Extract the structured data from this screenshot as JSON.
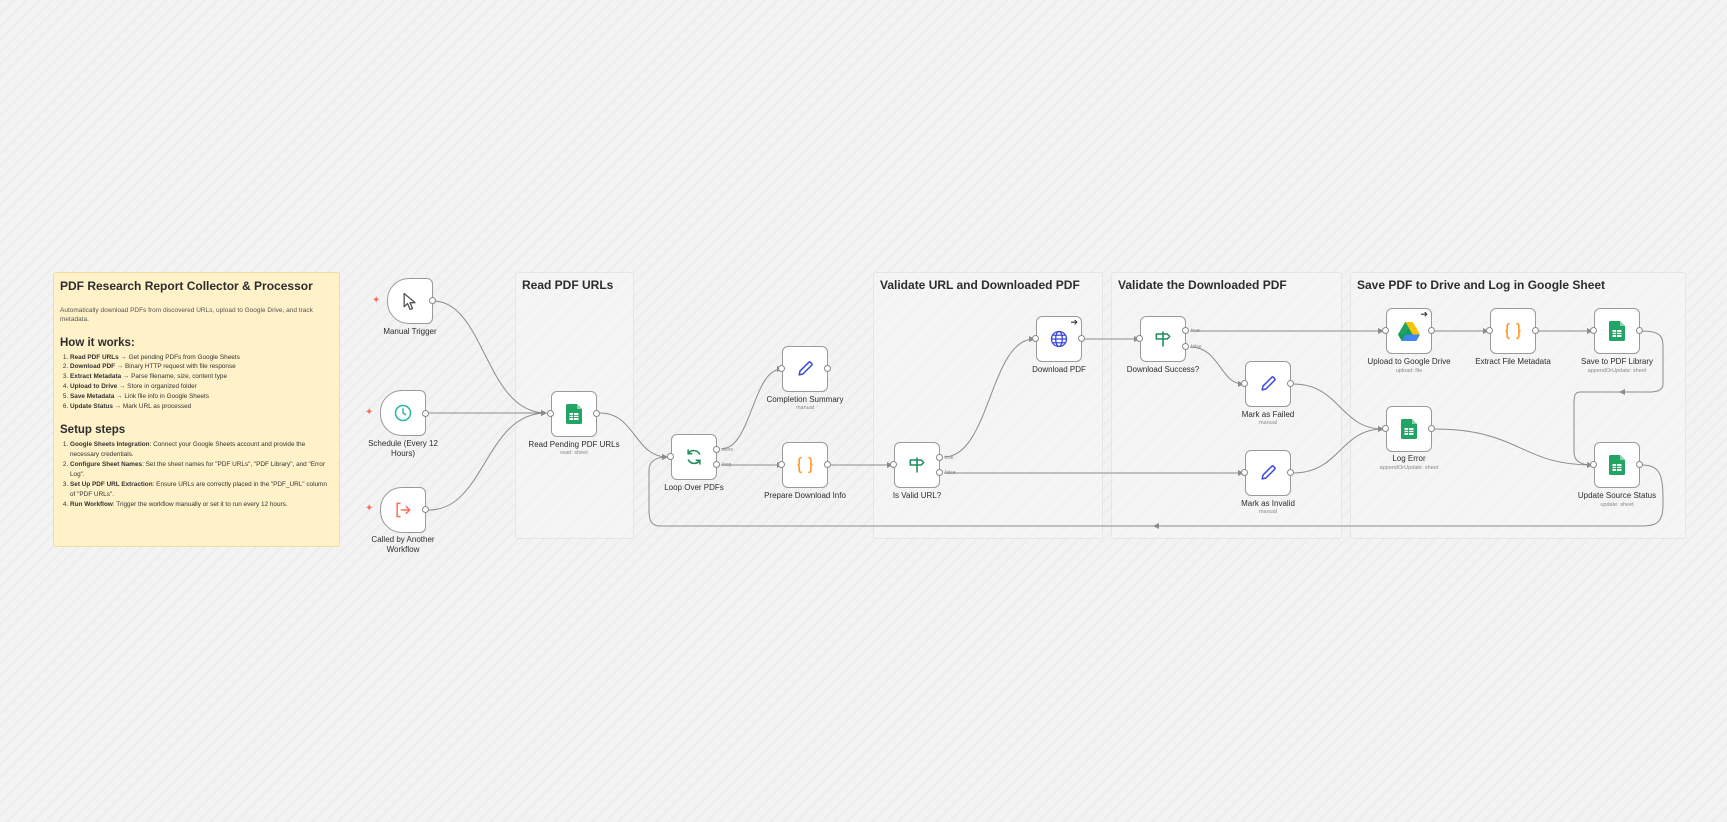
{
  "sticky": {
    "title": "PDF Research Report Collector & Processor",
    "description": "Automatically download PDFs from discovered URLs, upload to Google Drive, and track metadata.",
    "how_heading": "How it works:",
    "how_steps": [
      {
        "bold": "Read PDF URLs",
        "text": " → Get pending PDFs from Google Sheets"
      },
      {
        "bold": "Download PDF",
        "text": " → Binary HTTP request with file response"
      },
      {
        "bold": "Extract Metadata",
        "text": " → Parse filename, size, content type"
      },
      {
        "bold": "Upload to Drive",
        "text": " → Store in organized folder"
      },
      {
        "bold": "Save Metadata",
        "text": " → Link file info in Google Sheets"
      },
      {
        "bold": "Update Status",
        "text": " → Mark URL as processed"
      }
    ],
    "setup_heading": "Setup steps",
    "setup_steps": [
      {
        "bold": "Google Sheets Integration",
        "text": ": Connect your Google Sheets account and provide the necessary credentials."
      },
      {
        "bold": "Configure Sheet Names",
        "text": ": Set the sheet names for \"PDF URLs\", \"PDF Library\", and \"Error Log\"."
      },
      {
        "bold": "Set Up PDF URL Extraction",
        "text": ": Ensure URLs are correctly placed in the \"PDF_URL\" column of \"PDF URLs\"."
      },
      {
        "bold": "Run Workflow",
        "text": ": Trigger the workflow manually or set it to run every 12 hours."
      }
    ]
  },
  "groups": {
    "read_urls": "Read PDF URLs",
    "validate_url": "Validate URL and Downloaded PDF",
    "validate_pdf": "Validate the Downloaded PDF",
    "save_drive": "Save PDF to Drive and Log in Google Sheet"
  },
  "nodes": {
    "manual_trigger": {
      "label": "Manual Trigger",
      "icon": "cursor-icon"
    },
    "schedule": {
      "label": "Schedule (Every 12 Hours)",
      "icon": "clock-icon"
    },
    "called_by_workflow": {
      "label": "Called by Another Workflow",
      "icon": "sign-in-icon"
    },
    "read_pending": {
      "label": "Read Pending PDF URLs",
      "sub": "read: sheet",
      "icon": "google-sheets-icon"
    },
    "loop": {
      "label": "Loop Over PDFs",
      "icon": "loop-icon",
      "ports": {
        "done": "done",
        "loop": "loop"
      }
    },
    "completion": {
      "label": "Completion Summary",
      "sub": "manual",
      "icon": "pencil-icon"
    },
    "prepare": {
      "label": "Prepare Download Info",
      "icon": "code-braces-icon"
    },
    "is_valid": {
      "label": "Is Valid URL?",
      "icon": "signpost-icon",
      "ports": {
        "true": "true",
        "false": "false"
      }
    },
    "download": {
      "label": "Download PDF",
      "icon": "globe-icon"
    },
    "download_success": {
      "label": "Download Success?",
      "icon": "signpost-icon",
      "ports": {
        "true": "true",
        "false": "false"
      }
    },
    "mark_failed": {
      "label": "Mark as Failed",
      "sub": "manual",
      "icon": "pencil-icon"
    },
    "mark_invalid": {
      "label": "Mark as Invalid",
      "sub": "manual",
      "icon": "pencil-icon"
    },
    "upload_drive": {
      "label": "Upload to Google Drive",
      "sub": "upload: file",
      "icon": "google-drive-icon"
    },
    "extract_meta": {
      "label": "Extract File Metadata",
      "icon": "code-braces-icon"
    },
    "save_library": {
      "label": "Save to PDF Library",
      "sub": "appendOrUpdate: sheet",
      "icon": "google-sheets-icon"
    },
    "log_error": {
      "label": "Log Error",
      "sub": "appendOrUpdate: sheet",
      "icon": "google-sheets-icon"
    },
    "update_status": {
      "label": "Update Source Status",
      "sub": "update: sheet",
      "icon": "google-sheets-icon"
    }
  },
  "colors": {
    "sheets_green": "#21a464",
    "code_orange": "#ff9922",
    "pencil_blue": "#3b4bd8",
    "if_green": "#1f8d5a",
    "clock_teal": "#2bb5a8",
    "trigger_red": "#ff6d5a",
    "edge_gray": "#8c8c8c"
  }
}
